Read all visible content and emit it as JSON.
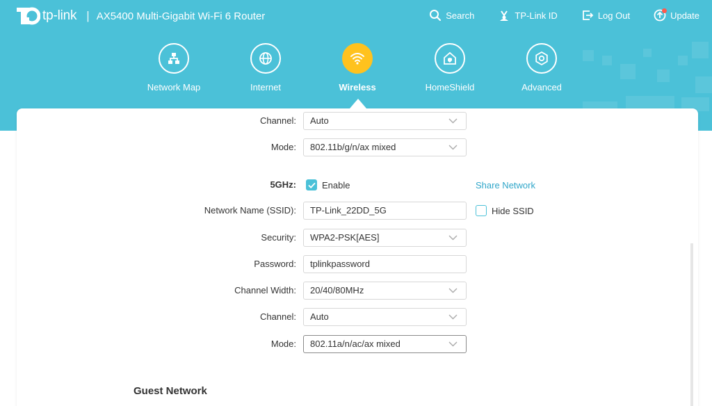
{
  "header": {
    "brand": "tp-link",
    "divider": "|",
    "model": "AX5400 Multi-Gigabit Wi-Fi 6 Router",
    "actions": [
      {
        "label": "Search",
        "icon": "search-icon"
      },
      {
        "label": "TP-Link ID",
        "icon": "tplink-id-icon"
      },
      {
        "label": "Log Out",
        "icon": "logout-icon"
      },
      {
        "label": "Update",
        "icon": "update-icon"
      }
    ]
  },
  "nav": {
    "items": [
      {
        "label": "Network Map",
        "icon": "network-map-icon"
      },
      {
        "label": "Internet",
        "icon": "globe-icon"
      },
      {
        "label": "Wireless",
        "icon": "wifi-icon",
        "active": true
      },
      {
        "label": "HomeShield",
        "icon": "home-shield-icon"
      },
      {
        "label": "Advanced",
        "icon": "gear-icon"
      }
    ]
  },
  "band24": {
    "channel_label": "Channel:",
    "channel_value": "Auto",
    "mode_label": "Mode:",
    "mode_value": "802.11b/g/n/ax mixed"
  },
  "band5": {
    "band_label": "5GHz:",
    "enable_label": "Enable",
    "enabled": true,
    "share_network": "Share Network",
    "ssid_label": "Network Name (SSID):",
    "ssid_value": "TP-Link_22DD_5G",
    "hide_ssid_label": "Hide SSID",
    "hide_ssid": false,
    "security_label": "Security:",
    "security_value": "WPA2-PSK[AES]",
    "password_label": "Password:",
    "password_value": "tplinkpassword",
    "width_label": "Channel Width:",
    "width_value": "20/40/80MHz",
    "channel_label": "Channel:",
    "channel_value": "Auto",
    "mode_label": "Mode:",
    "mode_value": "802.11a/n/ac/ax mixed"
  },
  "guest": {
    "title": "Guest Network"
  },
  "colors": {
    "header_bg": "#4bc1d8",
    "active_nav": "#ffc21e",
    "link": "#2fa6c9",
    "checkbox": "#4bc1d8"
  }
}
